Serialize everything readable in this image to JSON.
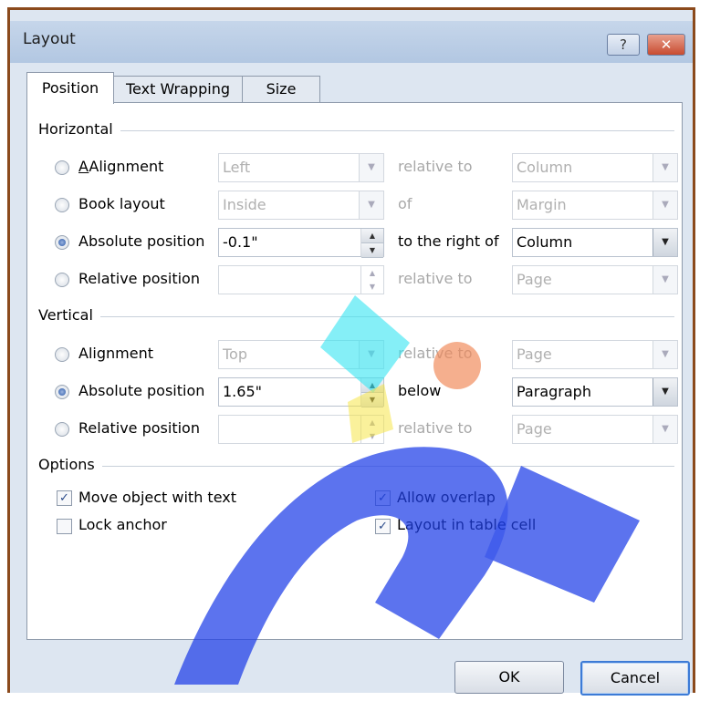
{
  "window": {
    "title": "Layout",
    "help_glyph": "?",
    "close_glyph": "✕"
  },
  "tabs": [
    {
      "label": "Position"
    },
    {
      "label": "Text Wrapping"
    },
    {
      "label": "Size"
    }
  ],
  "horizontal": {
    "heading": "Horizontal",
    "rows": [
      {
        "label": "Alignment",
        "value": "Left",
        "relation": "relative to",
        "target": "Column",
        "selected": false
      },
      {
        "label": "Book layout",
        "value": "Inside",
        "relation": "of",
        "target": "Margin",
        "selected": false
      },
      {
        "label": "Absolute position",
        "value": "-0.1\"",
        "relation": "to the right of",
        "target": "Column",
        "selected": true
      },
      {
        "label": "Relative position",
        "value": "",
        "relation": "relative to",
        "target": "Page",
        "selected": false
      }
    ]
  },
  "vertical": {
    "heading": "Vertical",
    "rows": [
      {
        "label": "Alignment",
        "value": "Top",
        "relation": "relative to",
        "target": "Page",
        "selected": false
      },
      {
        "label": "Absolute position",
        "value": "1.65\"",
        "relation": "below",
        "target": "Paragraph",
        "selected": true
      },
      {
        "label": "Relative position",
        "value": "",
        "relation": "relative to",
        "target": "Page",
        "selected": false
      }
    ]
  },
  "options": {
    "heading": "Options",
    "items": [
      {
        "label": "Move object with text",
        "checked": true
      },
      {
        "label": "Lock anchor",
        "checked": false
      },
      {
        "label": "Allow overlap",
        "checked": true
      },
      {
        "label": "Layout in table cell",
        "checked": true
      }
    ]
  },
  "buttons": {
    "ok": "OK",
    "cancel": "Cancel"
  },
  "colors": {
    "frame": "#8b4a1c",
    "titlebar": "#b9cce4",
    "accent": "#3d7bd6"
  }
}
